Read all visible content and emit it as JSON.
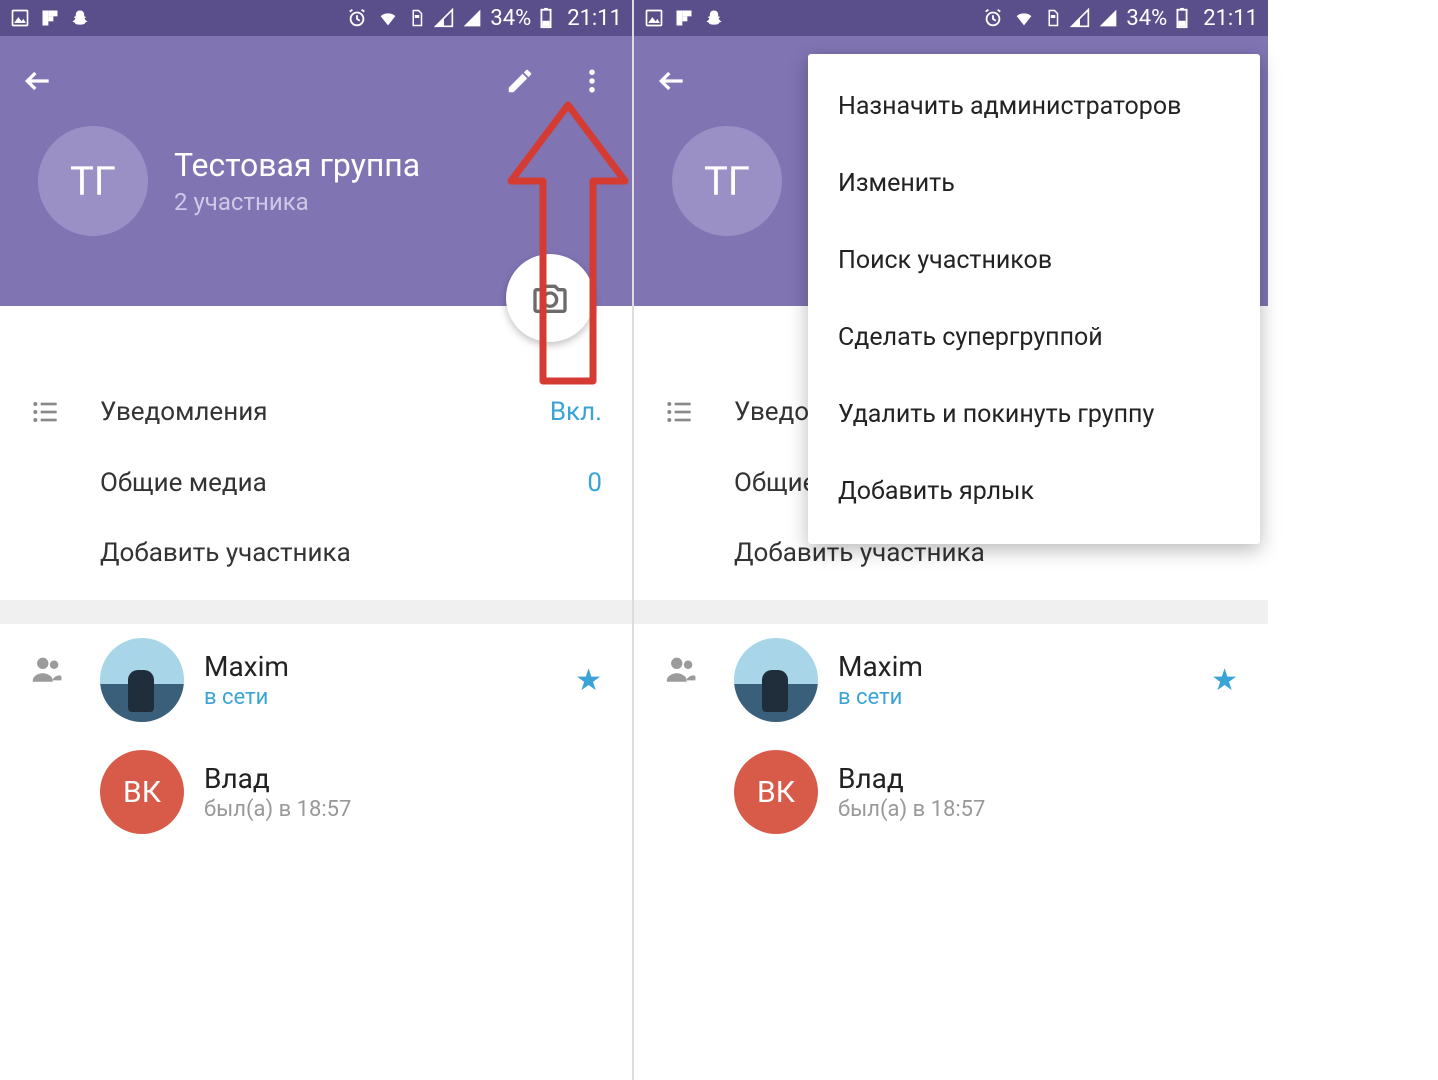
{
  "statusbar": {
    "battery_text": "34%",
    "time": "21:11"
  },
  "header": {
    "avatar_initials": "ТГ",
    "title": "Тестовая группа",
    "subtitle": "2 участника"
  },
  "rows": {
    "notifications_label": "Уведомления",
    "notifications_value": "Вкл.",
    "shared_media_label": "Общие медиа",
    "shared_media_value": "0",
    "add_member_label": "Добавить участника"
  },
  "members": [
    {
      "name": "Maxim",
      "status": "в сети",
      "status_color": "blue",
      "avatar_type": "photo",
      "avatar_text": "",
      "starred": true
    },
    {
      "name": "Влад",
      "status": "был(а) в 18:57",
      "status_color": "gray",
      "avatar_type": "red",
      "avatar_text": "ВК",
      "starred": false
    }
  ],
  "dropdown": {
    "items": [
      "Назначить администраторов",
      "Изменить",
      "Поиск участников",
      "Сделать супергруппой",
      "Удалить и покинуть группу",
      "Добавить ярлык"
    ]
  },
  "colors": {
    "header_bg": "#8074b3",
    "statusbar_bg": "#5a4f8a",
    "accent_blue": "#3aa4d6",
    "avatar_bg": "#9a90c6",
    "annotation_red": "#d43b32"
  }
}
